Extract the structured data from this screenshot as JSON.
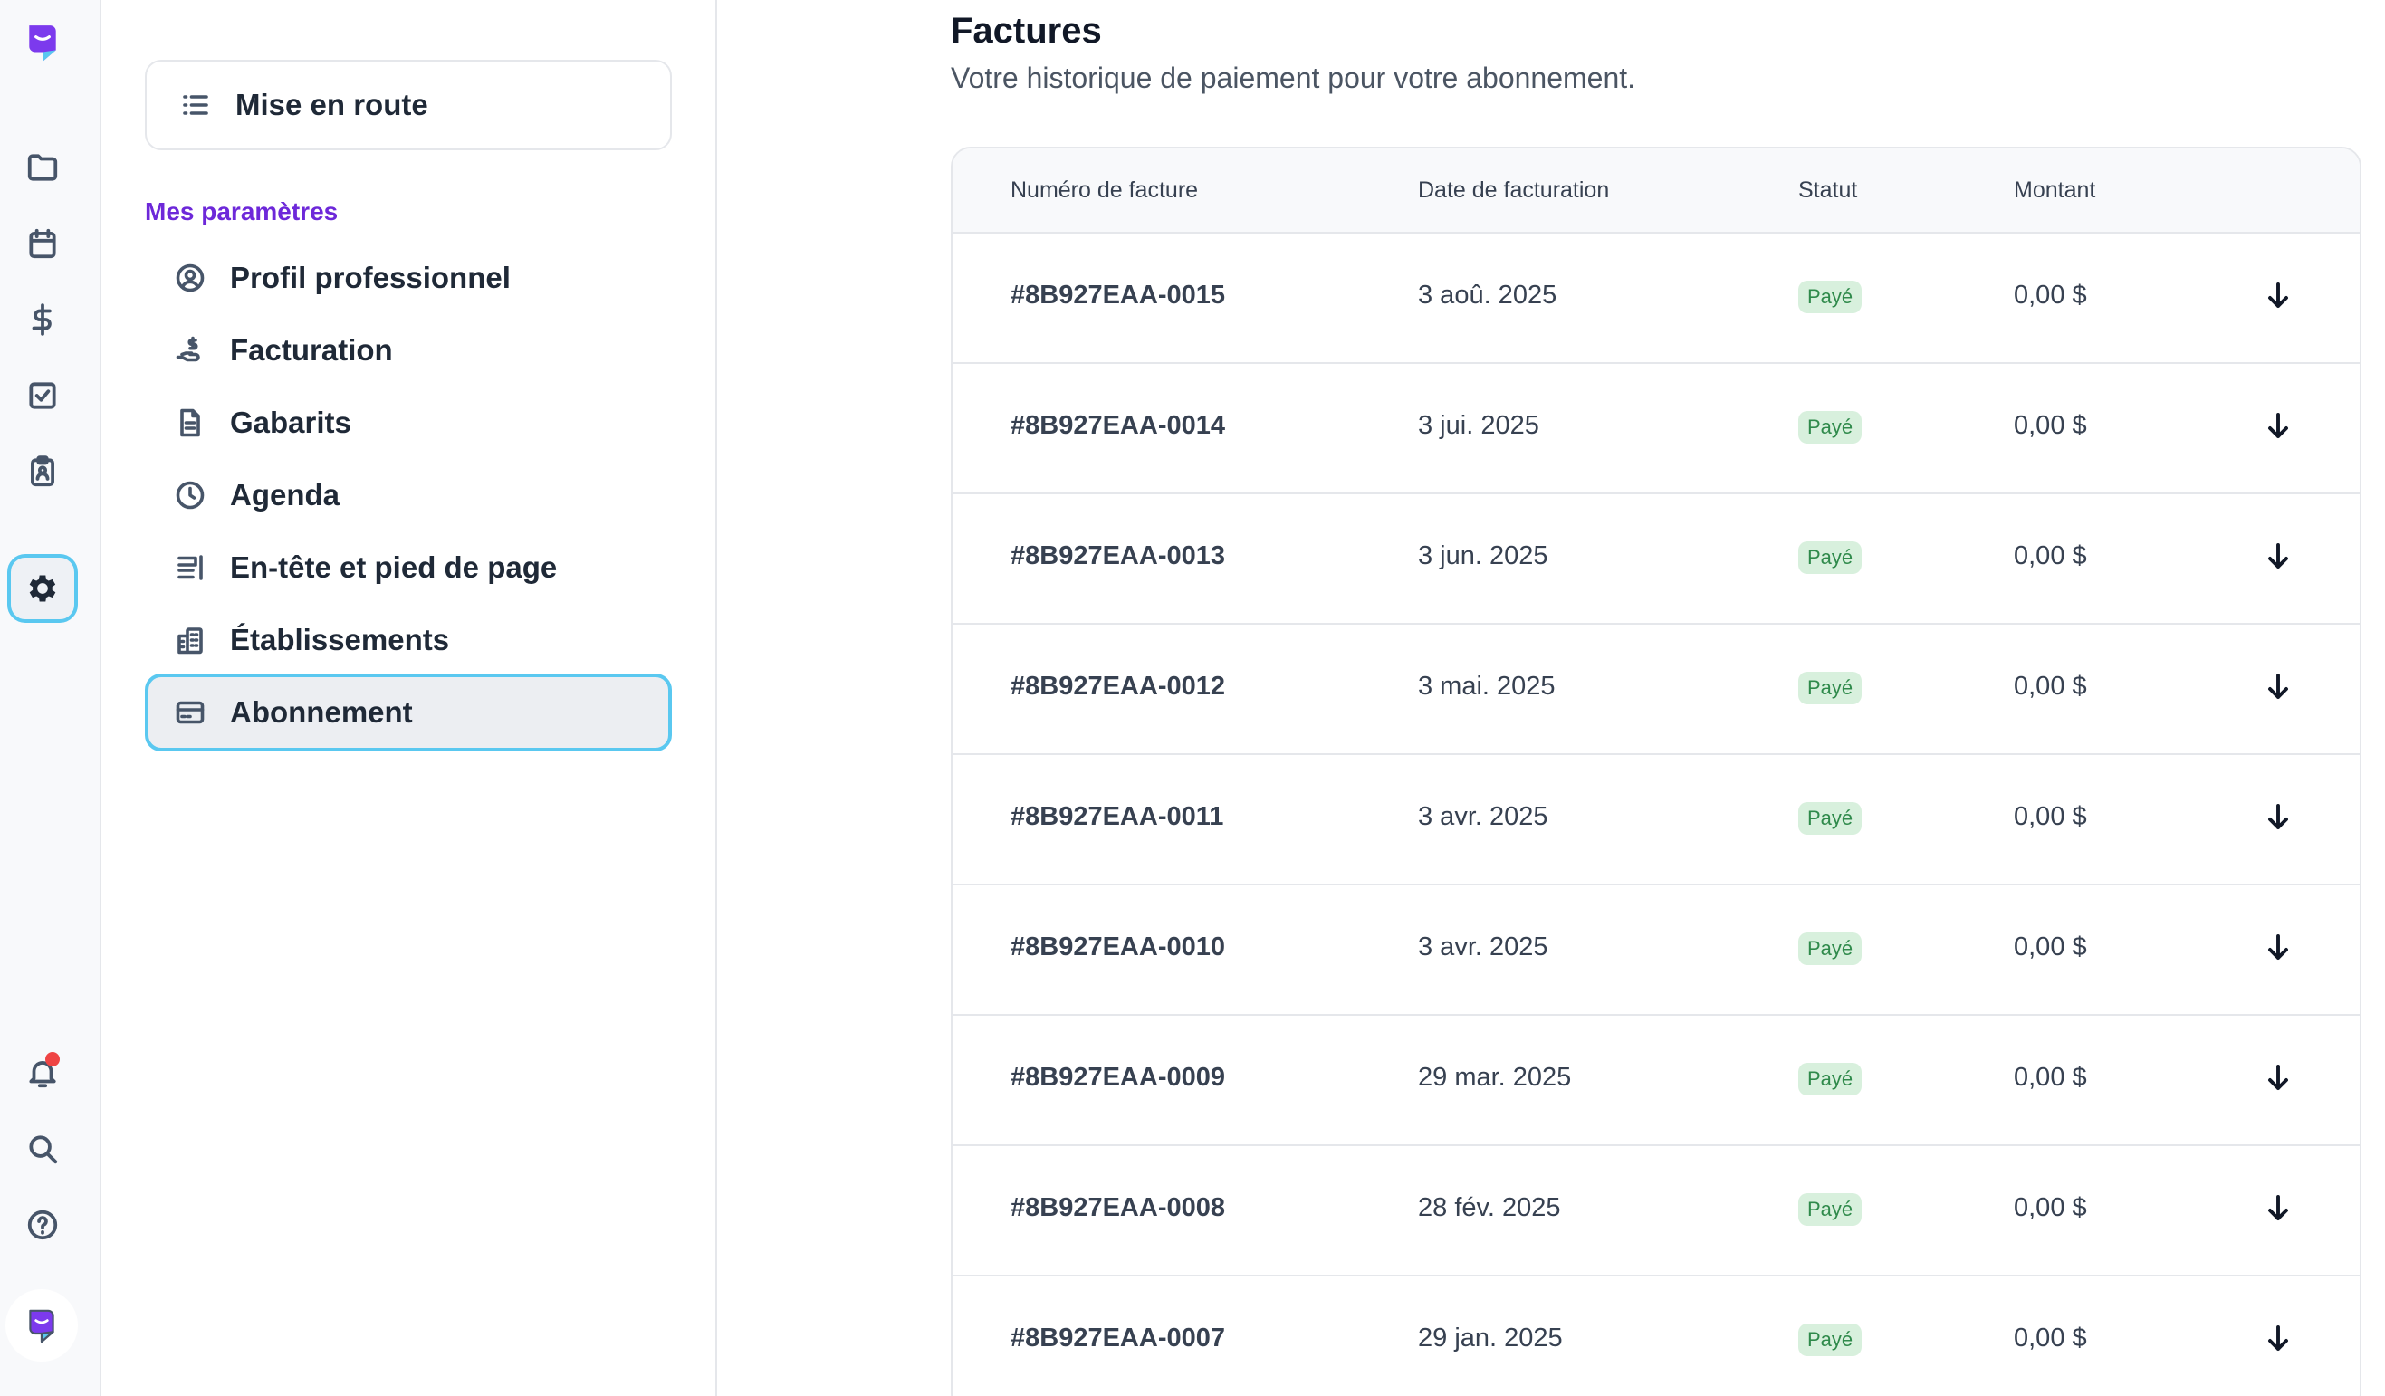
{
  "nav_rail": {
    "icons": [
      "logo-icon",
      "folder-icon",
      "calendar-icon",
      "dollar-icon",
      "checkbox-icon",
      "clipboard-user-icon",
      "gear-icon",
      "bell-icon",
      "search-icon",
      "help-icon",
      "avatar-logo-icon"
    ],
    "active": "gear-icon",
    "accent_color": "#5ac8f0",
    "brand_color": "#7c3aed",
    "notification_dot_color": "#ef4444"
  },
  "settings": {
    "getting_started": "Mise en route",
    "section_label": "Mes paramètres",
    "items": [
      {
        "label": "Profil professionnel",
        "icon": "user-circle-icon"
      },
      {
        "label": "Facturation",
        "icon": "hand-coin-icon"
      },
      {
        "label": "Gabarits",
        "icon": "document-icon"
      },
      {
        "label": "Agenda",
        "icon": "clock-icon"
      },
      {
        "label": "En-tête et pied de page",
        "icon": "header-footer-icon"
      },
      {
        "label": "Établissements",
        "icon": "buildings-icon"
      },
      {
        "label": "Abonnement",
        "icon": "credit-card-icon"
      }
    ],
    "selected": "Abonnement"
  },
  "main": {
    "title": "Factures",
    "subtitle": "Votre historique de paiement pour votre abonnement.",
    "table": {
      "headers": {
        "number": "Numéro de facture",
        "date": "Date de facturation",
        "status": "Statut",
        "amount": "Montant"
      },
      "rows": [
        {
          "number": "#8B927EAA-0015",
          "date": "3 aoû. 2025",
          "status": "Payé",
          "amount": "0,00 $"
        },
        {
          "number": "#8B927EAA-0014",
          "date": "3 jui. 2025",
          "status": "Payé",
          "amount": "0,00 $"
        },
        {
          "number": "#8B927EAA-0013",
          "date": "3 jun. 2025",
          "status": "Payé",
          "amount": "0,00 $"
        },
        {
          "number": "#8B927EAA-0012",
          "date": "3 mai. 2025",
          "status": "Payé",
          "amount": "0,00 $"
        },
        {
          "number": "#8B927EAA-0011",
          "date": "3 avr. 2025",
          "status": "Payé",
          "amount": "0,00 $"
        },
        {
          "number": "#8B927EAA-0010",
          "date": "3 avr. 2025",
          "status": "Payé",
          "amount": "0,00 $"
        },
        {
          "number": "#8B927EAA-0009",
          "date": "29 mar. 2025",
          "status": "Payé",
          "amount": "0,00 $"
        },
        {
          "number": "#8B927EAA-0008",
          "date": "28 fév. 2025",
          "status": "Payé",
          "amount": "0,00 $"
        },
        {
          "number": "#8B927EAA-0007",
          "date": "29 jan. 2025",
          "status": "Payé",
          "amount": "0,00 $"
        }
      ],
      "download_icon": "arrow-down-icon",
      "status_color": "#2f8a4b"
    }
  }
}
